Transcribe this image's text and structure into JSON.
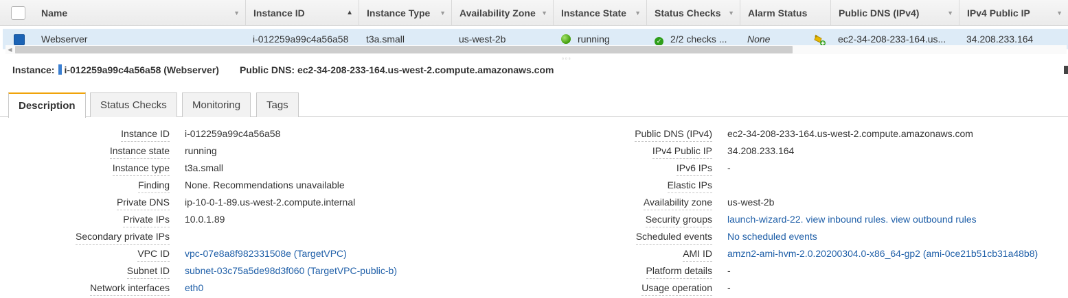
{
  "table": {
    "columns": [
      "Name",
      "Instance ID",
      "Instance Type",
      "Availability Zone",
      "Instance State",
      "Status Checks",
      "Alarm Status",
      "Public DNS (IPv4)",
      "IPv4 Public IP"
    ],
    "row": {
      "name": "Webserver",
      "instance_id": "i-012259a99c4a56a58",
      "instance_type": "t3a.small",
      "availability_zone": "us-west-2b",
      "instance_state": "running",
      "status_checks": "2/2 checks ...",
      "alarm_status": "None",
      "public_dns": "ec2-34-208-233-164.us...",
      "ipv4_public_ip": "34.208.233.164"
    }
  },
  "detail": {
    "instance_label": "Instance:",
    "instance_value": "i-012259a99c4a56a58 (Webserver)",
    "dns_label": "Public DNS:",
    "dns_value": "ec2-34-208-233-164.us-west-2.compute.amazonaws.com"
  },
  "tabs": [
    "Description",
    "Status Checks",
    "Monitoring",
    "Tags"
  ],
  "properties_left": [
    {
      "label": "Instance ID",
      "value": "i-012259a99c4a56a58"
    },
    {
      "label": "Instance state",
      "value": "running"
    },
    {
      "label": "Instance type",
      "value": "t3a.small"
    },
    {
      "label": "Finding",
      "value": "None. Recommendations unavailable"
    },
    {
      "label": "Private DNS",
      "value": "ip-10-0-1-89.us-west-2.compute.internal"
    },
    {
      "label": "Private IPs",
      "value": "10.0.1.89"
    },
    {
      "label": "Secondary private IPs",
      "value": ""
    },
    {
      "label": "VPC ID",
      "value": "vpc-07e8a8f982331508e (TargetVPC)"
    },
    {
      "label": "Subnet ID",
      "value": "subnet-03c75a5de98d3f060 (TargetVPC-public-b)"
    },
    {
      "label": "Network interfaces",
      "value": "eth0"
    }
  ],
  "properties_right": [
    {
      "label": "Public DNS (IPv4)",
      "value": "ec2-34-208-233-164.us-west-2.compute.amazonaws.com"
    },
    {
      "label": "IPv4 Public IP",
      "value": "34.208.233.164"
    },
    {
      "label": "IPv6 IPs",
      "value": "-"
    },
    {
      "label": "Elastic IPs",
      "value": ""
    },
    {
      "label": "Availability zone",
      "value": "us-west-2b"
    },
    {
      "label": "Security groups",
      "value": "launch-wizard-22. view inbound rules. view outbound rules"
    },
    {
      "label": "Scheduled events",
      "value": "No scheduled events"
    },
    {
      "label": "AMI ID",
      "value": "amzn2-ami-hvm-2.0.20200304.0-x86_64-gp2 (ami-0ce21b51cb31a48b8)"
    },
    {
      "label": "Platform details",
      "value": "-"
    },
    {
      "label": "Usage operation",
      "value": "-"
    }
  ],
  "icons": {
    "status_running": "green-dot-icon",
    "status_checks_passed": "check-circle-icon",
    "alarm": "alarm-bell-icon"
  },
  "colors": {
    "link": "#1f5fa8",
    "selected_row": "#ddebf7",
    "active_tab_accent": "#f0a30a",
    "running_green": "#3f9c0a"
  }
}
